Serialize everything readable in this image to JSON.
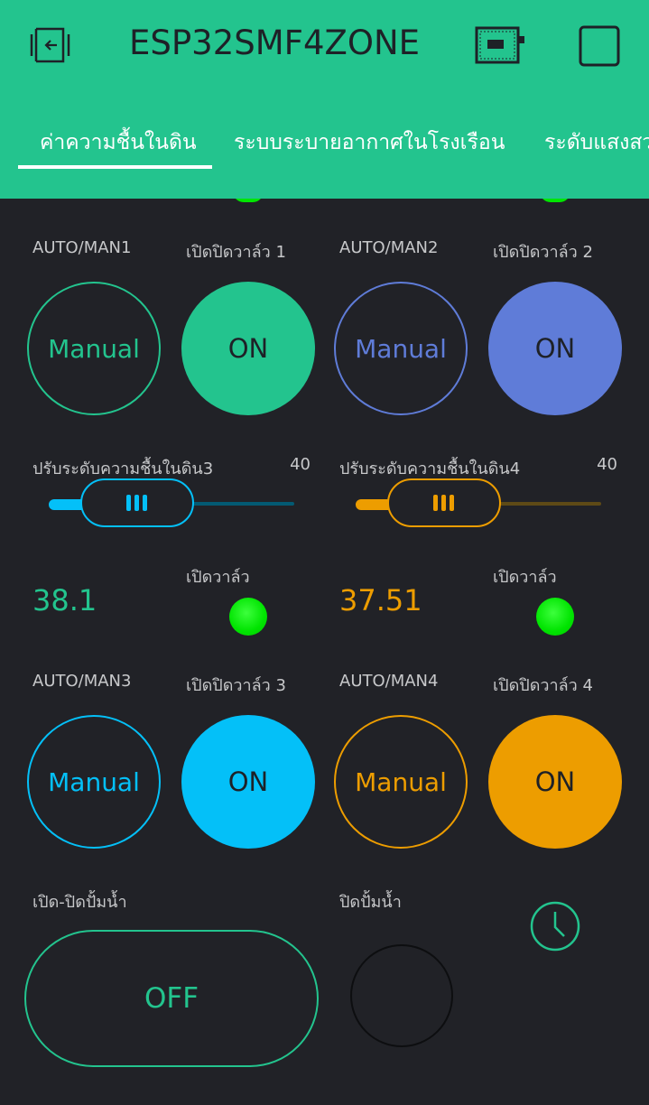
{
  "header": {
    "title": "ESP32SMF4ZONE",
    "background": "#23c48e",
    "icons": {
      "back": "exit-icon",
      "device": "device-board-icon",
      "status": "square-icon"
    }
  },
  "tabs": [
    {
      "label": "ค่าความชื้นในดิน",
      "active": true
    },
    {
      "label": "ระบบระบายอากาศในโรงเรือน",
      "active": false
    },
    {
      "label": "ระดับแสงสว",
      "active": false
    }
  ],
  "zones": {
    "z1": {
      "mode_label": "AUTO/MAN1",
      "mode_value": "Manual",
      "valve_label": "เปิดปิดวาล์ว 1",
      "valve_value": "ON",
      "color": "#23c48e"
    },
    "z2": {
      "mode_label": "AUTO/MAN2",
      "mode_value": "Manual",
      "valve_label": "เปิดปิดวาล์ว 2",
      "valve_value": "ON",
      "color": "#5f7cd8"
    },
    "z3": {
      "mode_label": "AUTO/MAN3",
      "mode_value": "Manual",
      "valve_label": "เปิดปิดวาล์ว 3",
      "valve_value": "ON",
      "color": "#04c0f8"
    },
    "z4": {
      "mode_label": "AUTO/MAN4",
      "mode_value": "Manual",
      "valve_label": "เปิดปิดวาล์ว 4",
      "valve_value": "ON",
      "color": "#ed9d00"
    }
  },
  "sliders": {
    "s3": {
      "label": "ปรับระดับความชื้นในดิน3",
      "value": "40",
      "fraction": 0.36,
      "color": "#04c0f8"
    },
    "s4": {
      "label": "ปรับระดับความชื้นในดิน4",
      "value": "40",
      "fraction": 0.36,
      "color": "#ed9d00"
    }
  },
  "readings": {
    "r3": {
      "value": "38.1",
      "color": "#23c48e",
      "led_label": "เปิดวาล์ว"
    },
    "r4": {
      "value": "37.51",
      "color": "#ed9d00",
      "led_label": "เปิดวาล์ว"
    }
  },
  "pump": {
    "label": "เปิด-ปิดปั้มน้ำ",
    "value": "OFF",
    "off_label": "ปิดปั้มน้ำ",
    "timer_icon": "clock-icon"
  }
}
